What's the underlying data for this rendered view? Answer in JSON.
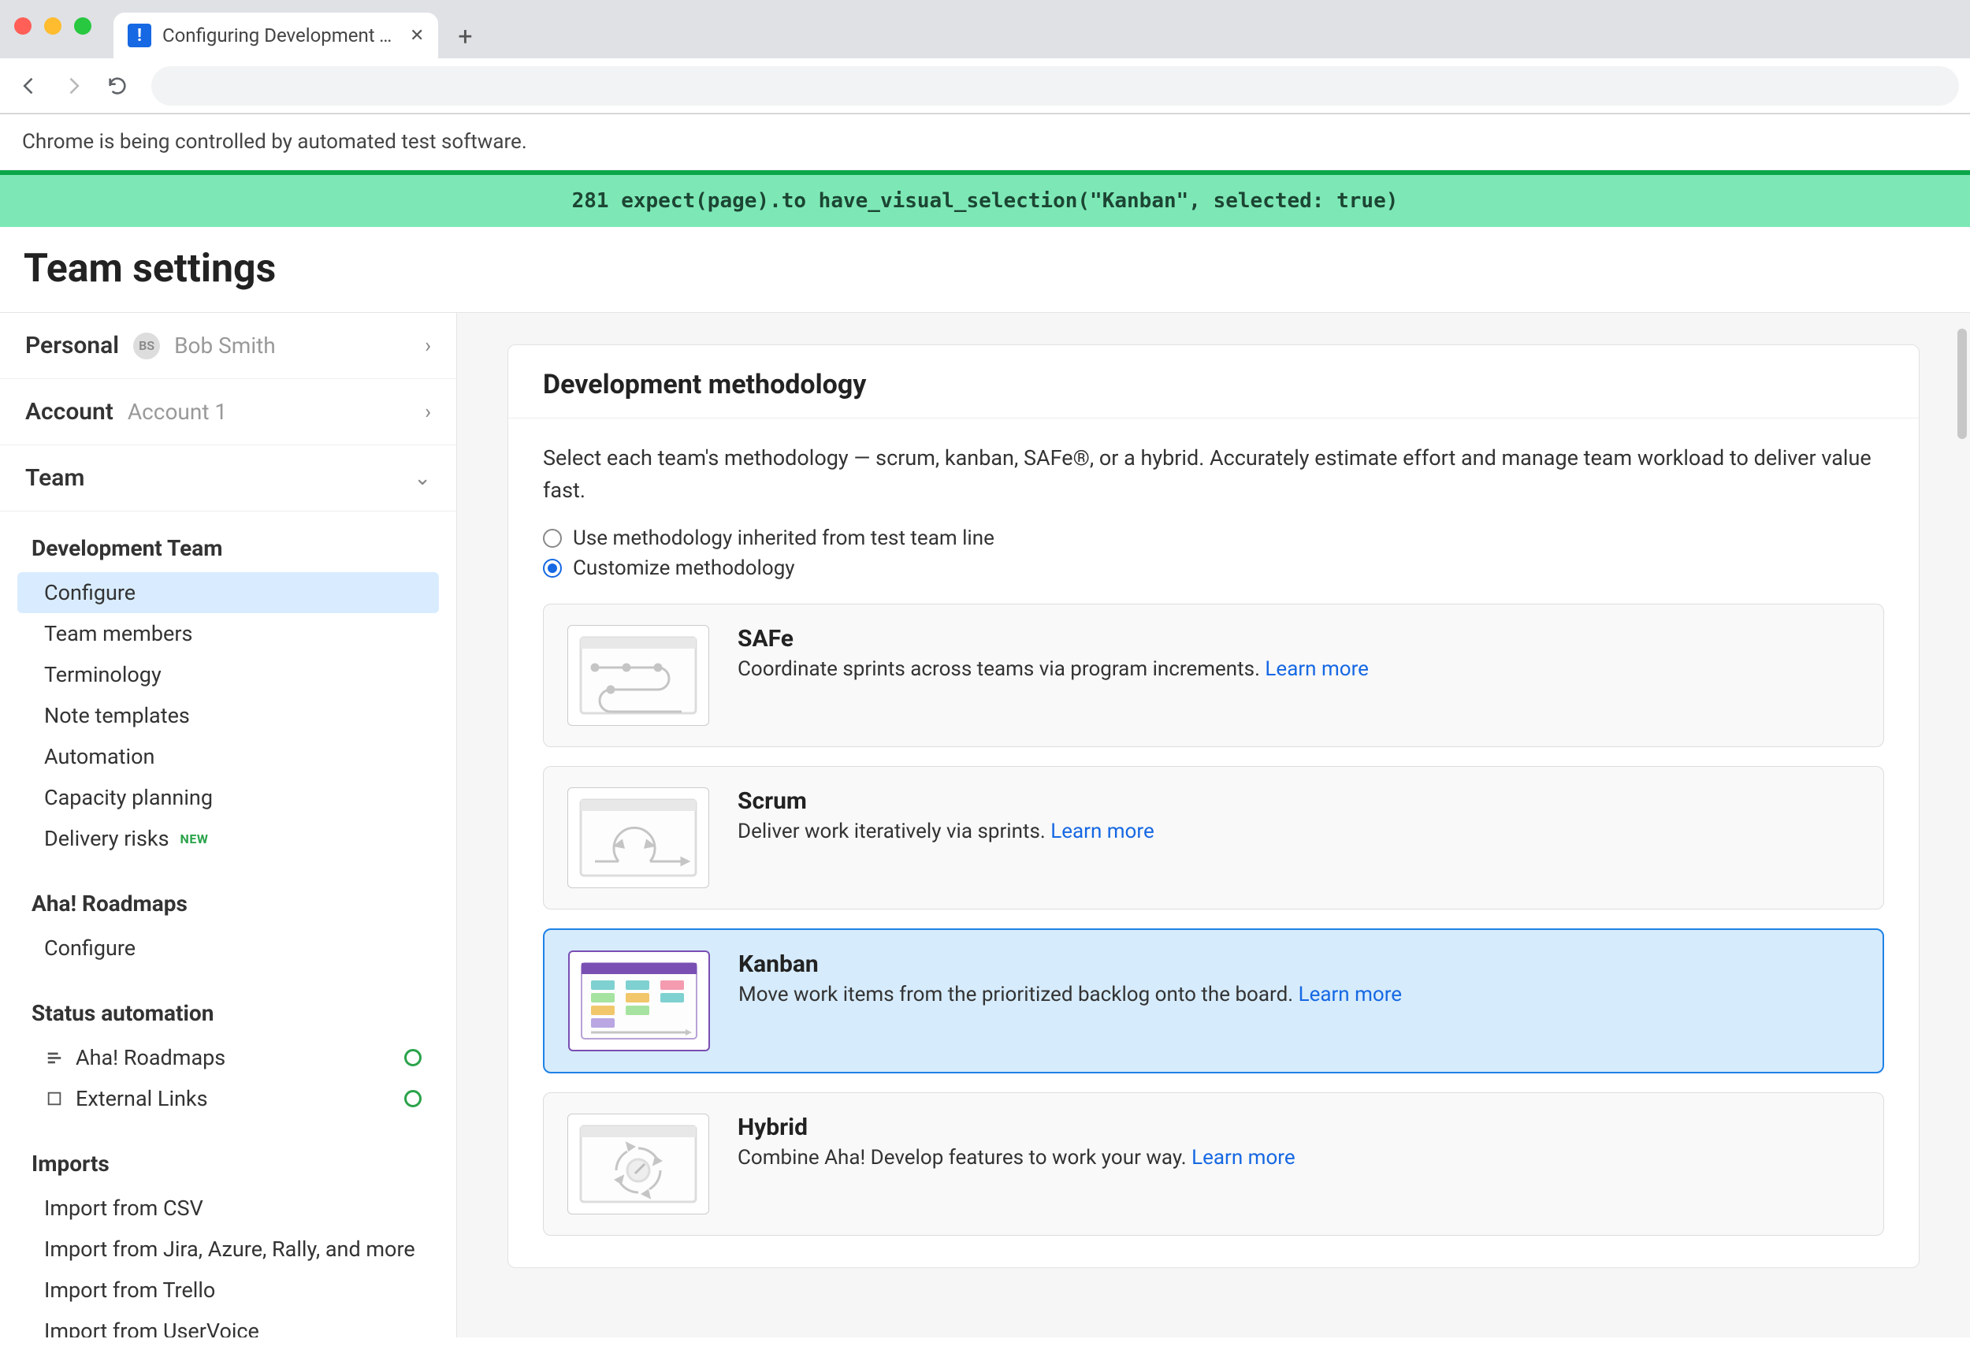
{
  "browser": {
    "tab_title": "Configuring Development Team",
    "automation_banner": "Chrome is being controlled by automated test software.",
    "test_line": "281 expect(page).to have_visual_selection(\"Kanban\", selected: true)"
  },
  "page": {
    "title": "Team settings"
  },
  "sidebar": {
    "personal": {
      "label": "Personal",
      "initials": "BS",
      "user": "Bob Smith"
    },
    "account": {
      "label": "Account",
      "name": "Account 1"
    },
    "team": {
      "label": "Team"
    },
    "groups": [
      {
        "title": "Development Team",
        "items": [
          {
            "label": "Configure",
            "active": true
          },
          {
            "label": "Team members"
          },
          {
            "label": "Terminology"
          },
          {
            "label": "Note templates"
          },
          {
            "label": "Automation"
          },
          {
            "label": "Capacity planning"
          },
          {
            "label": "Delivery risks",
            "badge": "NEW"
          }
        ]
      },
      {
        "title": "Aha! Roadmaps",
        "items": [
          {
            "label": "Configure"
          }
        ]
      },
      {
        "title": "Status automation",
        "items": [
          {
            "label": "Aha! Roadmaps",
            "icon": "roadmaps-icon",
            "status": true
          },
          {
            "label": "External Links",
            "icon": "external-icon",
            "status": true
          }
        ]
      },
      {
        "title": "Imports",
        "items": [
          {
            "label": "Import from CSV"
          },
          {
            "label": "Import from Jira, Azure, Rally, and more"
          },
          {
            "label": "Import from Trello"
          },
          {
            "label": "Import from UserVoice"
          }
        ]
      }
    ]
  },
  "main": {
    "heading": "Development methodology",
    "description": "Select each team's methodology — scrum, kanban, SAFe®, or a hybrid. Accurately estimate effort and manage team workload to deliver value fast.",
    "radios": {
      "inherit": "Use methodology inherited from test team line",
      "customize": "Customize methodology"
    },
    "learn_more": "Learn more",
    "cards": [
      {
        "key": "safe",
        "title": "SAFe",
        "desc": "Coordinate sprints across teams via program increments.",
        "selected": false
      },
      {
        "key": "scrum",
        "title": "Scrum",
        "desc": "Deliver work iteratively via sprints.",
        "selected": false
      },
      {
        "key": "kanban",
        "title": "Kanban",
        "desc": "Move work items from the prioritized backlog onto the board.",
        "selected": true
      },
      {
        "key": "hybrid",
        "title": "Hybrid",
        "desc": "Combine Aha! Develop features to work your way.",
        "selected": false
      }
    ]
  }
}
